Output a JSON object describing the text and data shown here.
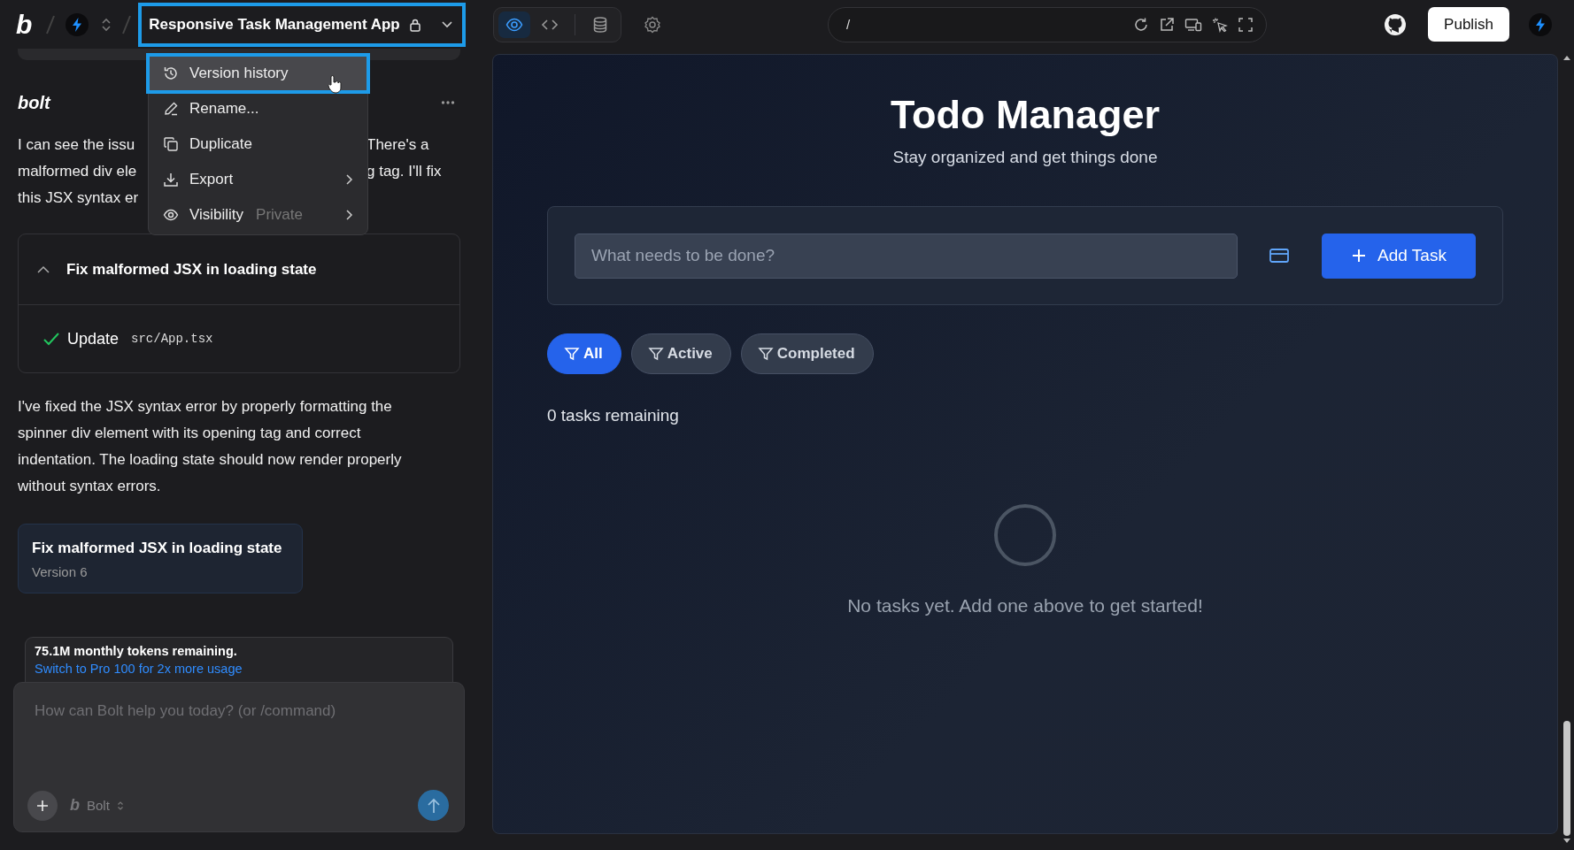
{
  "header": {
    "logo": "b",
    "project_title": "Responsive Task Management App",
    "title_highlighted": true,
    "project_menu": [
      {
        "label": "Version history",
        "selected": true,
        "submenu": false
      },
      {
        "label": "Rename...",
        "selected": false,
        "submenu": false
      },
      {
        "label": "Duplicate",
        "selected": false,
        "submenu": false
      },
      {
        "label": "Export",
        "selected": false,
        "submenu": true
      },
      {
        "label": "Visibility",
        "value": "Private",
        "selected": false,
        "submenu": true
      }
    ],
    "view_tabs": [
      {
        "kind": "preview",
        "selected": true
      },
      {
        "kind": "code",
        "selected": false
      },
      {
        "kind": "database",
        "selected": false
      }
    ],
    "url": "/",
    "publish_button": "Publish"
  },
  "chat": {
    "assistant_label": "bolt",
    "message_lines": [
      {
        "left": "I can see the issu",
        "right": "There's a"
      },
      {
        "left": "malformed div ele",
        "right": "g tag. I'll fix"
      },
      {
        "left": "this JSX syntax er"
      }
    ],
    "action_card": {
      "title": "Fix malformed JSX in loading state",
      "expanded": true,
      "steps": [
        {
          "action": "Update",
          "file": "src/App.tsx",
          "done": true
        }
      ]
    },
    "summary": "I've fixed the JSX syntax error by properly formatting the spinner div element with its opening tag and correct indentation. The loading state should now render properly without syntax errors.",
    "version_card": {
      "title": "Fix malformed JSX in loading state",
      "version": "Version 6"
    },
    "tokens": {
      "text": "75.1M monthly tokens remaining.",
      "link": "Switch to Pro 100 for 2x more usage"
    },
    "prompt": {
      "placeholder": "How can Bolt help you today? (or /command)",
      "model_logo": "b",
      "model": "Bolt"
    }
  },
  "preview": {
    "title": "Todo Manager",
    "subtitle": "Stay organized and get things done",
    "task_input": {
      "placeholder": "What needs to be done?"
    },
    "add_button": "Add Task",
    "filters": [
      {
        "label": "All",
        "selected": true
      },
      {
        "label": "Active",
        "selected": false
      },
      {
        "label": "Completed",
        "selected": false
      }
    ],
    "remaining": "0 tasks remaining",
    "loading": true,
    "empty_message": "No tasks yet. Add one above to get started!"
  }
}
